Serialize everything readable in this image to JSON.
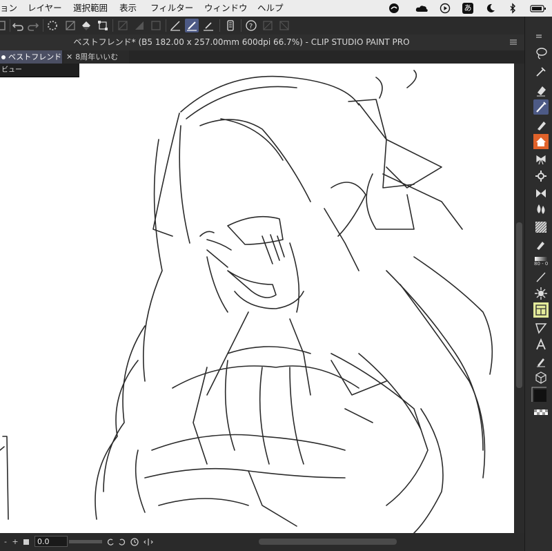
{
  "menubar": {
    "items": [
      "ョン",
      "レイヤー",
      "選択範囲",
      "表示",
      "フィルター",
      "ウィンドウ",
      "ヘルプ"
    ],
    "ime_label": "あ"
  },
  "window": {
    "title": "ベストフレンド* (B5 182.00 x 257.00mm 600dpi 66.7%)  - CLIP STUDIO PAINT PRO"
  },
  "tabs": [
    {
      "label": "ベストフレンド*"
    },
    {
      "label": "8周年いいむ"
    }
  ],
  "dropdown": {
    "label": "ビュー"
  },
  "bottombar": {
    "zoom_value": "0.0",
    "plus": "+",
    "minus": "-"
  },
  "palette": {
    "density_label": "80 - 0"
  },
  "colors": {
    "accent": "#4d5a86",
    "home_icon": "#e0622a",
    "current_color": "#111111"
  }
}
